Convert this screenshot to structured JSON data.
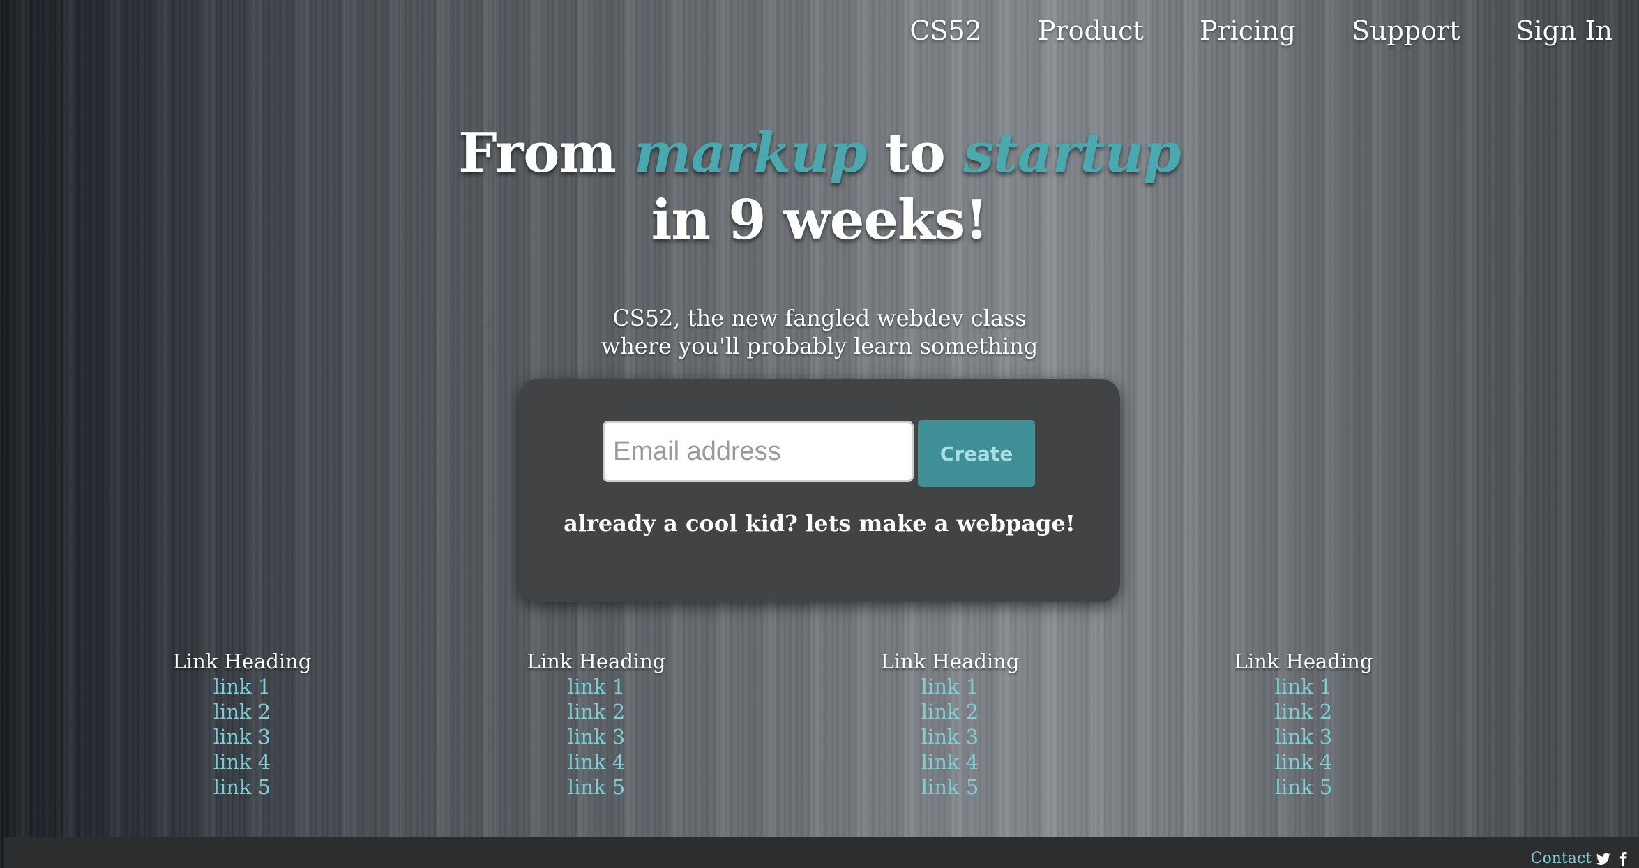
{
  "nav": {
    "items": [
      {
        "label": "CS52"
      },
      {
        "label": "Product"
      },
      {
        "label": "Pricing"
      },
      {
        "label": "Support"
      },
      {
        "label": "Sign In"
      }
    ]
  },
  "hero": {
    "title_from": "From",
    "title_markup": "markup",
    "title_to": "to",
    "title_startup": "startup",
    "title_line2": "in 9 weeks!",
    "subtitle_line1": "CS52, the new fangled webdev class",
    "subtitle_line2": "where you'll probably learn something"
  },
  "signup": {
    "email_placeholder": "Email address",
    "create_label": "Create",
    "cool_kid_text": "already a cool kid? lets make a webpage!"
  },
  "link_columns": [
    {
      "heading": "Link Heading",
      "links": [
        "link 1",
        "link 2",
        "link 3",
        "link 4",
        "link 5"
      ]
    },
    {
      "heading": "Link Heading",
      "links": [
        "link 1",
        "link 2",
        "link 3",
        "link 4",
        "link 5"
      ]
    },
    {
      "heading": "Link Heading",
      "links": [
        "link 1",
        "link 2",
        "link 3",
        "link 4",
        "link 5"
      ]
    },
    {
      "heading": "Link Heading",
      "links": [
        "link 1",
        "link 2",
        "link 3",
        "link 4",
        "link 5"
      ]
    }
  ],
  "footer": {
    "contact_label": "Contact",
    "icons": [
      "twitter-icon",
      "facebook-icon"
    ]
  },
  "colors": {
    "accent": "#4aa8af",
    "link": "#7ccfd6",
    "button": "#3f8f97",
    "panel": "#414344"
  }
}
